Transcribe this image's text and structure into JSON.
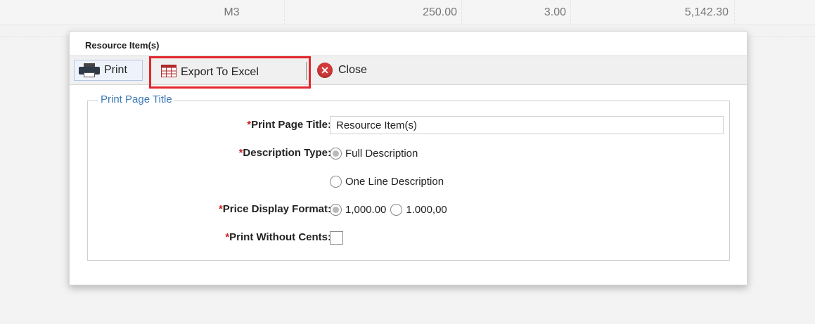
{
  "background_row": {
    "unit": "M3",
    "price": "250.00",
    "qty": "3.00",
    "total": "5,142.30"
  },
  "dialog": {
    "title": "Resource Item(s)",
    "toolbar": {
      "print_label": "Print",
      "export_label": "Export To Excel",
      "close_label": "Close"
    },
    "fieldset": {
      "legend": "Print Page Title",
      "required_mark": "*",
      "page_title": {
        "label": "Print Page Title:",
        "value": "Resource Item(s)"
      },
      "description_type": {
        "label": "Description Type:",
        "options": [
          "Full Description",
          "One Line Description"
        ],
        "selected": "Full Description"
      },
      "price_display_format": {
        "label": "Price Display Format:",
        "options": [
          "1,000.00",
          "1.000,00"
        ],
        "selected": "1,000.00"
      },
      "print_without_cents": {
        "label": "Print Without Cents:",
        "checked": false
      }
    }
  },
  "colors": {
    "highlight_border": "#e3262c",
    "legend_text": "#3b79b7",
    "required_mark": "#cc1f1f",
    "close_icon": "#d23a3a"
  },
  "icons": {
    "print": "printer-icon",
    "export": "spreadsheet-icon",
    "close": "close-circle-icon"
  }
}
